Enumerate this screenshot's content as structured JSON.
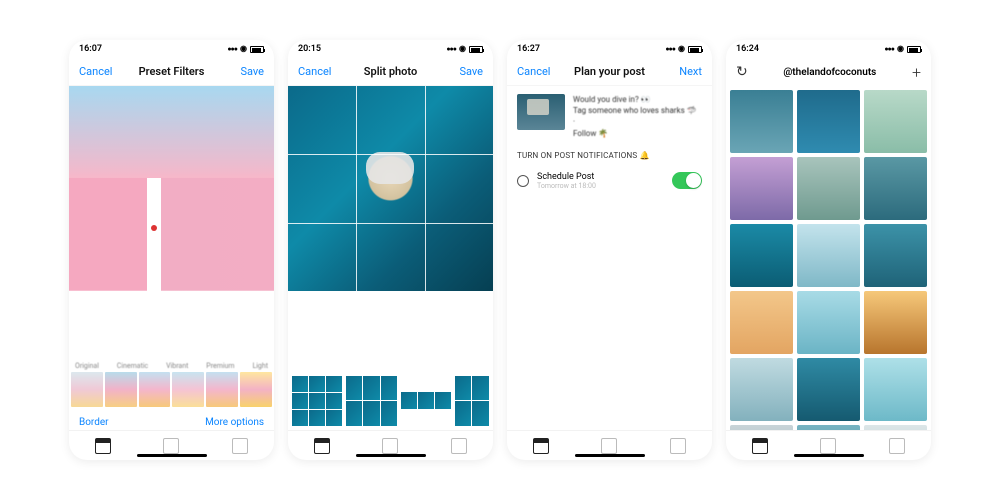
{
  "screen1": {
    "time": "16:07",
    "nav_left": "Cancel",
    "nav_title": "Preset Filters",
    "nav_right": "Save",
    "filter_labels": [
      "Original",
      "Cinematic",
      "Vibrant",
      "Premium",
      "Light"
    ],
    "bottom_left": "Border",
    "bottom_right": "More options"
  },
  "screen2": {
    "time": "20:15",
    "nav_left": "Cancel",
    "nav_title": "Split photo",
    "nav_right": "Save"
  },
  "screen3": {
    "time": "16:27",
    "nav_left": "Cancel",
    "nav_title": "Plan your post",
    "nav_right": "Next",
    "caption_l1": "Would you dive in? 👀",
    "caption_l2": "Tag someone who loves sharks 🦈",
    "caption_l3": "Follow 🌴",
    "notif": "TURN ON POST NOTIFICATIONS 🔔",
    "schedule_label": "Schedule Post",
    "schedule_sub": "Tomorrow at 18:00",
    "schedule_on": true
  },
  "screen4": {
    "time": "16:24",
    "handle": "@thelandofcoconuts"
  }
}
